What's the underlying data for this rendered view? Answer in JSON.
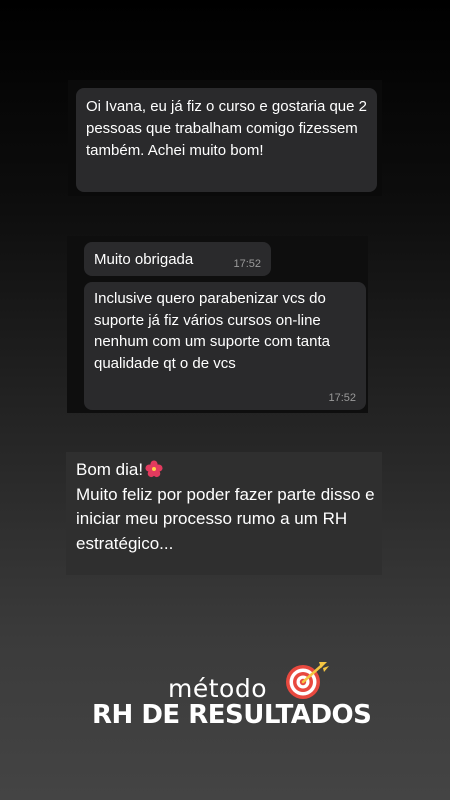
{
  "screenshot1": {
    "message": "Oi Ivana, eu já fiz o curso e gostaria que 2 pessoas que trabalham comigo fizessem também. Achei muito bom!"
  },
  "screenshot2": {
    "messages": [
      {
        "text": "Muito obrigada",
        "time": "17:52"
      },
      {
        "text": "Inclusive quero parabenizar vcs do suporte já fiz vários cursos on-line  nenhum com um suporte com tanta qualidade qt o de vcs",
        "time": "17:52"
      }
    ]
  },
  "screenshot3": {
    "greeting": "Bom dia!",
    "body": "Muito feliz por poder fazer parte disso e iniciar meu processo rumo a um RH estratégico...",
    "emoji_icon": "hibiscus-icon"
  },
  "logo": {
    "line1": "método",
    "line2": "RH DE RESULTADOS",
    "icon": "target-arrow-icon",
    "accent_color": "#e8493f",
    "arrow_color": "#f4c542"
  }
}
